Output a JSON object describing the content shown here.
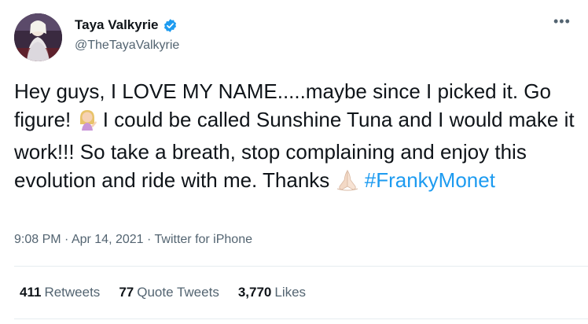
{
  "author": {
    "display_name": "Taya Valkyrie",
    "handle": "@TheTayaValkyrie",
    "verified_icon": "verified-badge-icon"
  },
  "menu": {
    "more_label": "•••"
  },
  "tweet": {
    "text_part1": "Hey guys, I LOVE MY NAME.....maybe since I picked it. Go figure! ",
    "emoji1": "woman-tipping-hand",
    "text_part2": " I could be called Sunshine Tuna and I would make it work!!! So take a breath, stop complaining and enjoy this evolution and ride with me. Thanks ",
    "emoji2": "folded-hands",
    "hashtag": "#FrankyMonet"
  },
  "meta": {
    "time": "9:08 PM",
    "sep1": " · ",
    "date": "Apr 14, 2021",
    "sep2": " · ",
    "source": "Twitter for iPhone"
  },
  "stats": [
    {
      "count": "411",
      "label": "Retweets"
    },
    {
      "count": "77",
      "label": "Quote Tweets"
    },
    {
      "count": "3,770",
      "label": "Likes"
    }
  ],
  "colors": {
    "link": "#1d9bf0",
    "secondary_text": "#536471",
    "primary_text": "#0f1419",
    "divider": "#e6ecf0"
  }
}
